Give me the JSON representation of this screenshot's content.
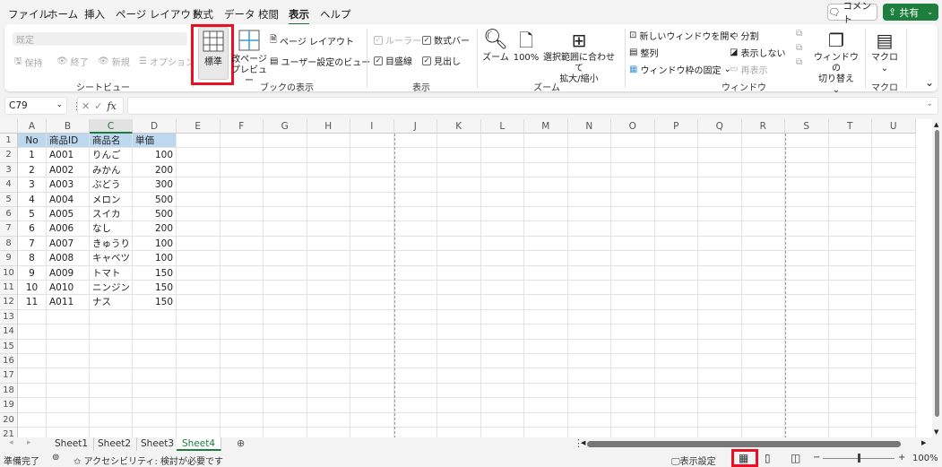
{
  "menu": {
    "tabs": [
      "ファイル",
      "ホーム",
      "挿入",
      "ページ レイアウト",
      "数式",
      "データ",
      "校閲",
      "表示",
      "ヘルプ"
    ],
    "active": "表示",
    "comment": "コメント",
    "share": "共有"
  },
  "ribbon": {
    "sheetview": {
      "dropdown": "既定",
      "keep": "保持",
      "exit": "終了",
      "new": "新規",
      "options": "オプション",
      "label": "シートビュー"
    },
    "workbookview": {
      "normal": "標準",
      "pagebreak1": "改ページ",
      "pagebreak2": "プレビュー",
      "pagelayout": "ページ レイアウト",
      "custom": "ユーザー設定のビュー",
      "label": "ブックの表示"
    },
    "show": {
      "ruler": "ルーラー",
      "formulabar": "数式バー",
      "gridlines": "目盛線",
      "headings": "見出し",
      "label": "表示"
    },
    "zoom": {
      "zoom": "ズーム",
      "hundred": "100%",
      "fit1": "選択範囲に合わせて",
      "fit2": "拡大/縮小",
      "label": "ズーム"
    },
    "window": {
      "newwin": "新しいウィンドウを開く",
      "arrange": "整列",
      "freeze": "ウィンドウ枠の固定",
      "split": "分割",
      "hide": "表示しない",
      "unhide": "再表示",
      "switch1": "ウィンドウの",
      "switch2": "切り替え",
      "label": "ウィンドウ"
    },
    "macro": {
      "macro": "マクロ",
      "label": "マクロ"
    }
  },
  "formula": {
    "namebox": "C79",
    "value": ""
  },
  "sheet": {
    "columns": [
      "A",
      "B",
      "C",
      "D",
      "E",
      "F",
      "G",
      "H",
      "I",
      "J",
      "K",
      "L",
      "M",
      "N",
      "O",
      "P",
      "Q",
      "R",
      "S",
      "T",
      "U"
    ],
    "selected_column": "C",
    "row_count": 21,
    "header": [
      "No",
      "商品ID",
      "商品名",
      "単価"
    ],
    "rows": [
      [
        "1",
        "A001",
        "りんご",
        "100"
      ],
      [
        "2",
        "A002",
        "みかん",
        "200"
      ],
      [
        "3",
        "A003",
        "ぶどう",
        "300"
      ],
      [
        "4",
        "A004",
        "メロン",
        "500"
      ],
      [
        "5",
        "A005",
        "スイカ",
        "500"
      ],
      [
        "6",
        "A006",
        "なし",
        "200"
      ],
      [
        "7",
        "A007",
        "きゅうり",
        "100"
      ],
      [
        "8",
        "A008",
        "キャベツ",
        "100"
      ],
      [
        "9",
        "A009",
        "トマト",
        "150"
      ],
      [
        "10",
        "A010",
        "ニンジン",
        "150"
      ],
      [
        "11",
        "A011",
        "ナス",
        "150"
      ]
    ]
  },
  "sheets": [
    "Sheet1",
    "Sheet2",
    "Sheet3",
    "Sheet4"
  ],
  "active_sheet": "Sheet4",
  "status": {
    "ready": "準備完了",
    "accessibility": "アクセシビリティ: 検討が必要です",
    "display_settings": "表示設定",
    "zoom": "100%"
  },
  "colors": {
    "accent": "#1e7e3e",
    "highlight": "#e81123",
    "header_fill": "#bdd7ee"
  }
}
